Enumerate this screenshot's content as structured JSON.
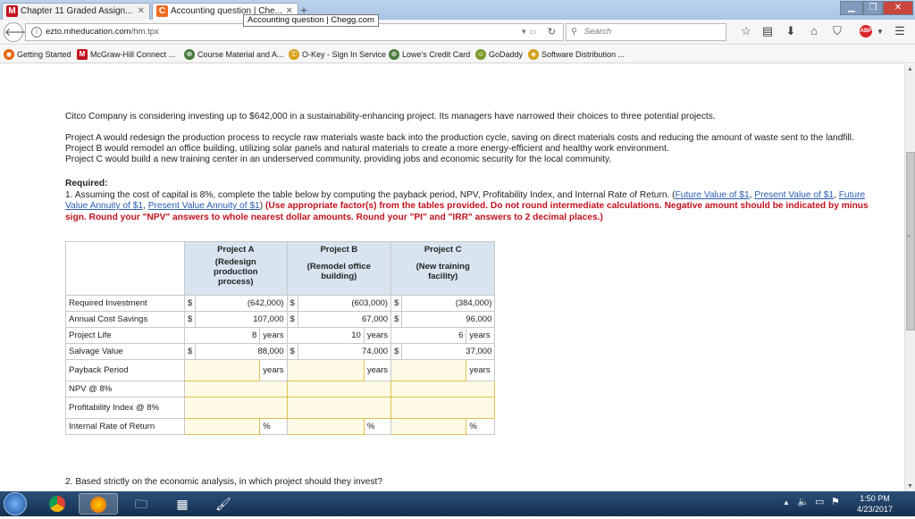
{
  "browser": {
    "tabs": [
      {
        "icon": "M",
        "label": "Chapter 11 Graded Assign...",
        "color": "#c1121f"
      },
      {
        "icon": "C",
        "label": "Accounting question | Che...",
        "color": "#f26b21"
      }
    ],
    "tooltip": "Accounting question | Chegg.com",
    "new_tab": "+",
    "url_host": "ezto.mheducation.com",
    "url_path": "/hm.tpx",
    "search_placeholder": "Search",
    "abp": "ABP"
  },
  "bookmarks": [
    {
      "icon": "firefox-icon",
      "label": "Getting Started",
      "color": "#e66000"
    },
    {
      "icon": "mcgraw-icon",
      "label": "McGraw-Hill Connect ...",
      "color": "#c1121f"
    },
    {
      "icon": "globe-icon",
      "label": "Course Material and A...",
      "color": "#4a7a3a"
    },
    {
      "icon": "okey-icon",
      "label": "O-Key - Sign In Service",
      "color": "#d4a017"
    },
    {
      "icon": "globe-icon",
      "label": "Lowe's Credit Card",
      "color": "#4a7a3a"
    },
    {
      "icon": "godaddy-icon",
      "label": "GoDaddy",
      "color": "#7a9a2a"
    },
    {
      "icon": "software-icon",
      "label": "Software Distribution ...",
      "color": "#d4a017"
    }
  ],
  "content": {
    "intro": "Citco Company is considering investing up to $642,000 in a sustainability-enhancing project. Its managers have narrowed their choices to three potential projects.",
    "projA": "Project A would redesign the production process to recycle raw materials waste back into the production cycle, saving on direct materials costs and reducing the amount of waste sent to the landfill.",
    "projB": "Project B would remodel an office building, utilizing solar panels and natural materials to create a more energy-efficient and healthy work environment.",
    "projC": "Project C would build a new training center in an underserved community, providing jobs and economic security for the local community.",
    "required_label": "Required:",
    "req1_pre": "1. Assuming the cost of capital is 8%, complete the table below by computing the payback period, NPV, Profitability Index, and Internal Rate of Return. (",
    "link1": "Future Value of $1",
    "link2": "Present Value of $1",
    "link3": "Future Value Annuity of $1",
    "link4": "Present Value Annuity of $1",
    "req1_post": ")",
    "req1_red": "(Use appropriate factor(s) from the tables provided. Do not round intermediate calculations. Negative amount should be indicated by minus sign. Round your \"NPV\" answers to whole nearest dollar amounts. Round your \"PI\" and \"IRR\" answers to 2 decimal places.)",
    "q2": "2. Based strictly on the economic analysis, in which project should they invest?"
  },
  "table": {
    "headers": [
      {
        "title": "Project A",
        "sub": "(Redesign production process)"
      },
      {
        "title": "Project B",
        "sub": "(Remodel office building)"
      },
      {
        "title": "Project C",
        "sub": "(New training facility)"
      }
    ],
    "rows": [
      {
        "label": "Required Investment",
        "cur": "$",
        "a": "(642,000)",
        "b": "(603,000)",
        "c": "(384,000)"
      },
      {
        "label": "Annual Cost Savings",
        "cur": "$",
        "a": "107,000",
        "b": "67,000",
        "c": "96,000"
      },
      {
        "label": "Project Life",
        "a": "8",
        "b": "10",
        "c": "6",
        "unit": "years"
      },
      {
        "label": "Salvage Value",
        "cur": "$",
        "a": "88,000",
        "b": "74,000",
        "c": "37,000"
      },
      {
        "label": "Payback Period",
        "unit": "years"
      },
      {
        "label": "NPV @ 8%"
      },
      {
        "label": "Profitability Index @ 8%"
      },
      {
        "label": "Internal Rate of Return",
        "unit": "%"
      }
    ]
  },
  "taskbar": {
    "time": "1:50 PM",
    "date": "4/23/2017"
  }
}
